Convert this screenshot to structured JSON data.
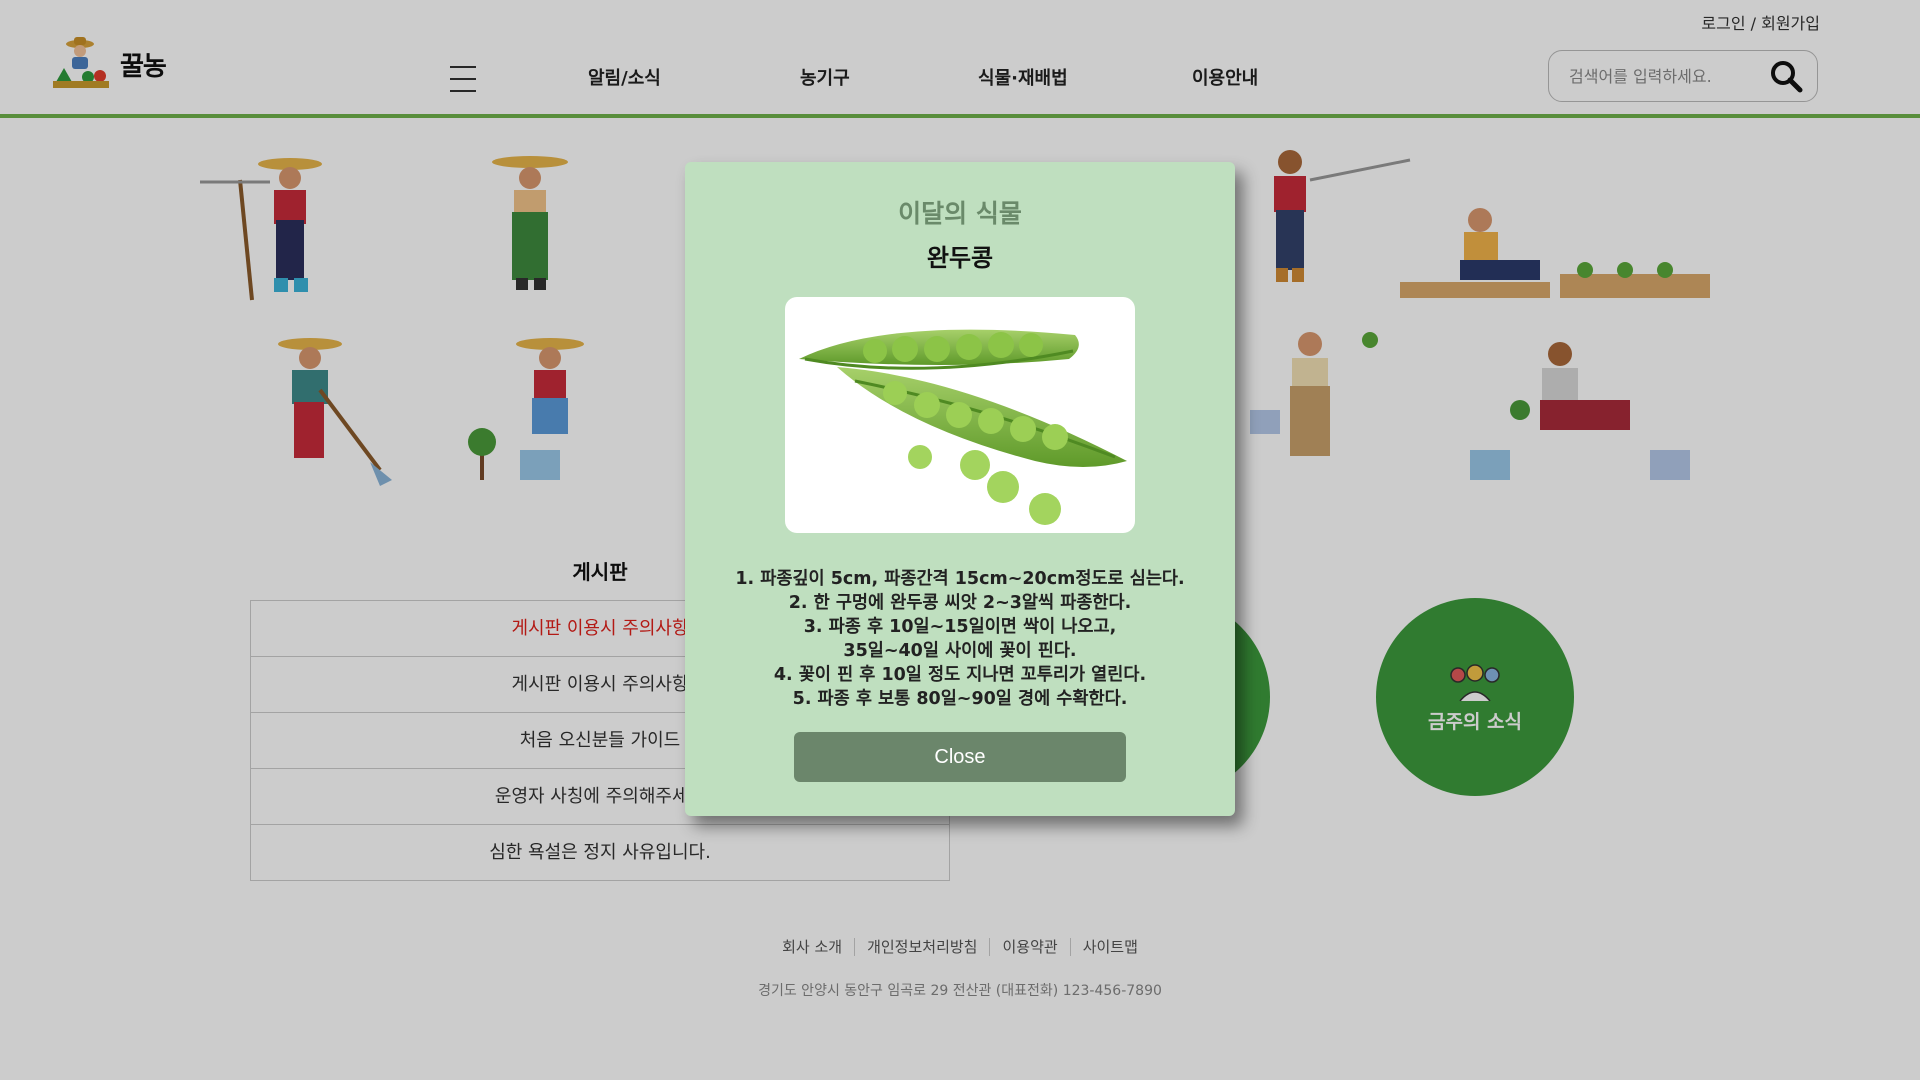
{
  "header": {
    "logo_text": "꿀농",
    "auth_login": "로그인",
    "auth_sep": " / ",
    "auth_signup": "회원가입",
    "nav": [
      "알림/소식",
      "농기구",
      "식물·재배법",
      "이용안내"
    ],
    "search_placeholder": "검색어를 입력하세요."
  },
  "board": {
    "title": "게시판",
    "rows": [
      "게시판 이용시 주의사항",
      "게시판 이용시 주의사항",
      "처음 오신분들 가이드",
      "운영자 사칭에 주의해주세요",
      "심한 욕설은 정지 사유입니다."
    ]
  },
  "circles": {
    "right_label": "금주의 소식"
  },
  "footer": {
    "links": [
      "회사 소개",
      "개인정보처리방침",
      "이용약관",
      "사이트맵"
    ],
    "address": "경기도 안양시 동안구 임곡로 29 전산관 (대표전화) 123-456-7890"
  },
  "modal": {
    "heading": "이달의 식물",
    "plant": "완두콩",
    "steps": [
      "1. 파종깊이 5cm, 파종간격 15cm~20cm정도로 심는다.",
      "2. 한 구멍에 완두콩 씨앗 2~3알씩 파종한다.",
      "3. 파종 후 10일~15일이면 싹이 나오고,",
      "35일~40일 사이에 꽃이 핀다.",
      "4. 꽃이 핀 후 10일 정도 지나면 꼬투리가 열린다.",
      "5. 파종 후 보통 80일~90일 경에 수확한다."
    ],
    "close_label": "Close"
  },
  "colors": {
    "brand_green": "#6fb24a",
    "circle_green": "#3d9a3d",
    "modal_bg": "#bfdfbf",
    "close_btn": "#6b866b",
    "notice_red": "#e0201a"
  }
}
